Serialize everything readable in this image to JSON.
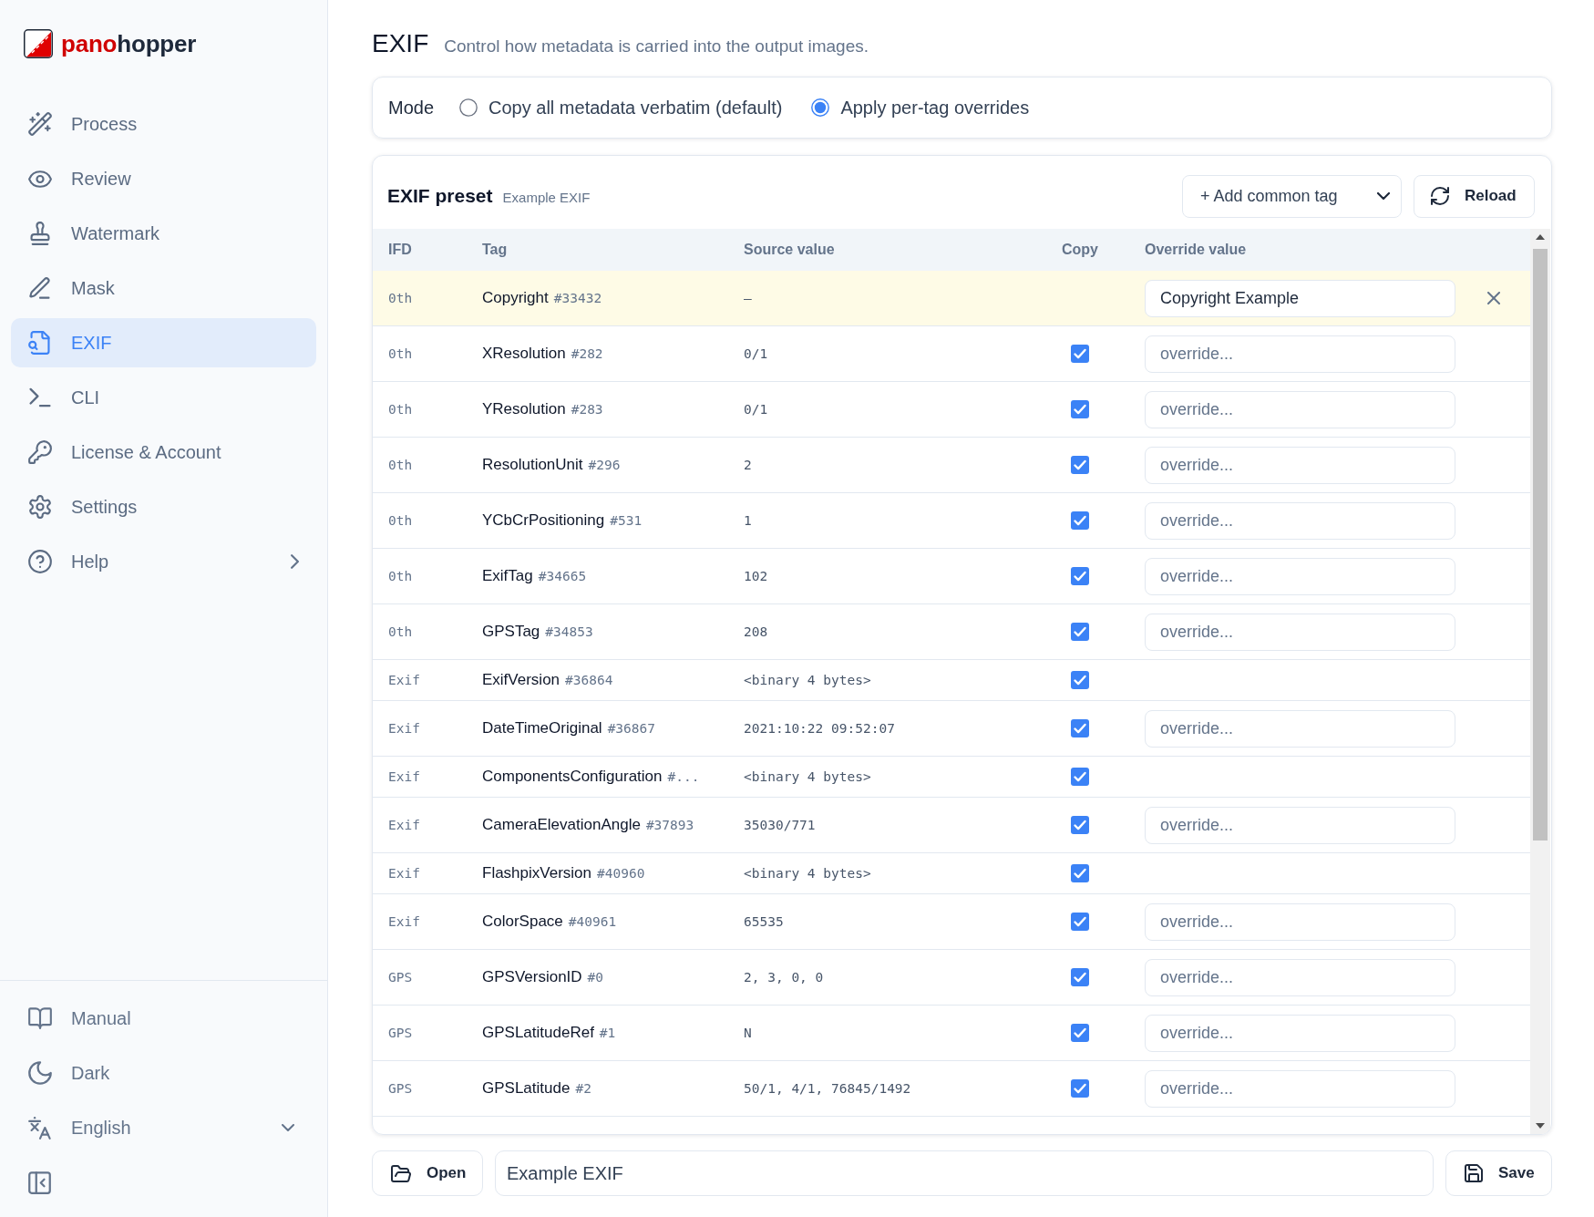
{
  "sidebar": {
    "logo": {
      "accent": "pano",
      "rest": "hopper"
    },
    "nav": [
      {
        "label": "Process",
        "kind": "page",
        "selected": false
      },
      {
        "label": "Review",
        "kind": "page",
        "selected": false
      },
      {
        "label": "Watermark",
        "kind": "page",
        "selected": false
      },
      {
        "label": "Mask",
        "kind": "page",
        "selected": false
      },
      {
        "label": "EXIF",
        "kind": "page",
        "selected": true
      },
      {
        "label": "CLI",
        "kind": "page",
        "selected": false
      },
      {
        "label": "License & Account",
        "kind": "page",
        "selected": false
      },
      {
        "label": "Settings",
        "kind": "page",
        "selected": false
      },
      {
        "label": "Help",
        "kind": "submenu",
        "selected": false
      }
    ],
    "footer": [
      {
        "label": "Manual",
        "kind": "plain"
      },
      {
        "label": "Dark",
        "kind": "plain"
      },
      {
        "label": "English",
        "kind": "dropdown"
      }
    ]
  },
  "header": {
    "title": "EXIF",
    "subtitle": "Control how metadata is carried into the output images."
  },
  "mode": {
    "label": "Mode",
    "options": [
      {
        "label": "Copy all metadata verbatim (default)",
        "selected": false
      },
      {
        "label": "Apply per-tag overrides",
        "selected": true
      }
    ]
  },
  "preset": {
    "title": "EXIF preset",
    "subtitle": "Example EXIF",
    "add_tag": "+ Add common tag",
    "reload": "Reload",
    "table": {
      "columns": [
        "IFD",
        "Tag",
        "Source value",
        "Copy",
        "Override value"
      ],
      "rows": [
        {
          "kind": "override",
          "ifd": "0th",
          "tag": "Copyright",
          "tag_id": "#33432",
          "source": "–",
          "override": {
            "value": "Copyright Example"
          }
        },
        {
          "kind": "copy",
          "ifd": "0th",
          "tag": "XResolution",
          "tag_id": "#282",
          "source": "0/1",
          "checked": true,
          "override": {
            "placeholder": "override..."
          }
        },
        {
          "kind": "copy",
          "ifd": "0th",
          "tag": "YResolution",
          "tag_id": "#283",
          "source": "0/1",
          "checked": true,
          "override": {
            "placeholder": "override..."
          }
        },
        {
          "kind": "copy",
          "ifd": "0th",
          "tag": "ResolutionUnit",
          "tag_id": "#296",
          "source": "2",
          "checked": true,
          "override": {
            "placeholder": "override..."
          }
        },
        {
          "kind": "copy",
          "ifd": "0th",
          "tag": "YCbCrPositioning",
          "tag_id": "#531",
          "source": "1",
          "checked": true,
          "override": {
            "placeholder": "override..."
          }
        },
        {
          "kind": "copy",
          "ifd": "0th",
          "tag": "ExifTag",
          "tag_id": "#34665",
          "source": "102",
          "checked": true,
          "override": {
            "placeholder": "override..."
          }
        },
        {
          "kind": "copy",
          "ifd": "0th",
          "tag": "GPSTag",
          "tag_id": "#34853",
          "source": "208",
          "checked": true,
          "override": {
            "placeholder": "override..."
          }
        },
        {
          "kind": "fixed",
          "ifd": "Exif",
          "tag": "ExifVersion",
          "tag_id": "#36864",
          "source": "<binary 4 bytes>",
          "checked": true
        },
        {
          "kind": "copy",
          "ifd": "Exif",
          "tag": "DateTimeOriginal",
          "tag_id": "#36867",
          "source": "2021:10:22 09:52:07",
          "checked": true,
          "override": {
            "placeholder": "override..."
          }
        },
        {
          "kind": "fixed",
          "ifd": "Exif",
          "tag": "ComponentsConfiguration",
          "tag_id": "#...",
          "source": "<binary 4 bytes>",
          "checked": true
        },
        {
          "kind": "copy",
          "ifd": "Exif",
          "tag": "CameraElevationAngle",
          "tag_id": "#37893",
          "source": "35030/771",
          "checked": true,
          "override": {
            "placeholder": "override..."
          }
        },
        {
          "kind": "fixed",
          "ifd": "Exif",
          "tag": "FlashpixVersion",
          "tag_id": "#40960",
          "source": "<binary 4 bytes>",
          "checked": true
        },
        {
          "kind": "copy",
          "ifd": "Exif",
          "tag": "ColorSpace",
          "tag_id": "#40961",
          "source": "65535",
          "checked": true,
          "override": {
            "placeholder": "override..."
          }
        },
        {
          "kind": "copy",
          "ifd": "GPS",
          "tag": "GPSVersionID",
          "tag_id": "#0",
          "source": "2, 3, 0, 0",
          "checked": true,
          "override": {
            "placeholder": "override..."
          }
        },
        {
          "kind": "copy",
          "ifd": "GPS",
          "tag": "GPSLatitudeRef",
          "tag_id": "#1",
          "source": "N",
          "checked": true,
          "override": {
            "placeholder": "override..."
          }
        },
        {
          "kind": "copy",
          "ifd": "GPS",
          "tag": "GPSLatitude",
          "tag_id": "#2",
          "source": "50/1, 4/1, 76845/1492",
          "checked": true,
          "override": {
            "placeholder": "override..."
          }
        }
      ]
    }
  },
  "file_bar": {
    "open": "Open",
    "filename": "Example EXIF",
    "save": "Save"
  }
}
